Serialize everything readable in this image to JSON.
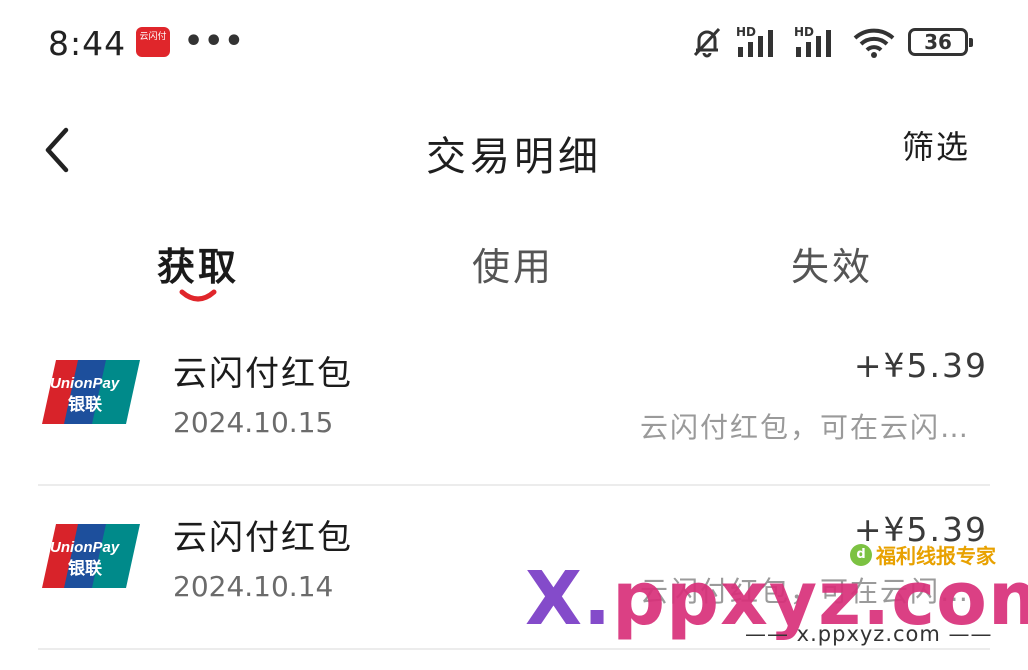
{
  "status_bar": {
    "time": "8:44",
    "app_icon_text": "云闪付",
    "more": "•••",
    "icons": [
      "bell-muted-icon",
      "hd-signal-icon",
      "hd-signal-icon",
      "wifi-icon"
    ],
    "hd_label": "HD",
    "battery": "36"
  },
  "nav": {
    "title": "交易明细",
    "filter_label": "筛选",
    "back_icon": "chevron-left-icon"
  },
  "tabs": [
    {
      "label": "获取",
      "active": true
    },
    {
      "label": "使用",
      "active": false
    },
    {
      "label": "失效",
      "active": false
    }
  ],
  "transactions": [
    {
      "title": "云闪付红包",
      "date": "2024.10.15",
      "amount": "+¥5.39",
      "description": "云闪付红包，可在云闪…",
      "logo_text": [
        "UnionPay",
        "银联"
      ]
    },
    {
      "title": "云闪付红包",
      "date": "2024.10.14",
      "amount": "+¥5.39",
      "description": "云闪付红包，可在云闪…",
      "logo_text": [
        "UnionPay",
        "银联"
      ]
    }
  ],
  "watermark": {
    "badge": "福利线报专家",
    "brand_part1": "X.",
    "brand_part2": "ppxyz.com",
    "url": "—— x.ppxyz.com ——"
  },
  "colors": {
    "accent": "#e0262b",
    "unionpay_red": "#d8232a",
    "unionpay_blue": "#1d4f9c",
    "unionpay_teal": "#008a8a"
  }
}
